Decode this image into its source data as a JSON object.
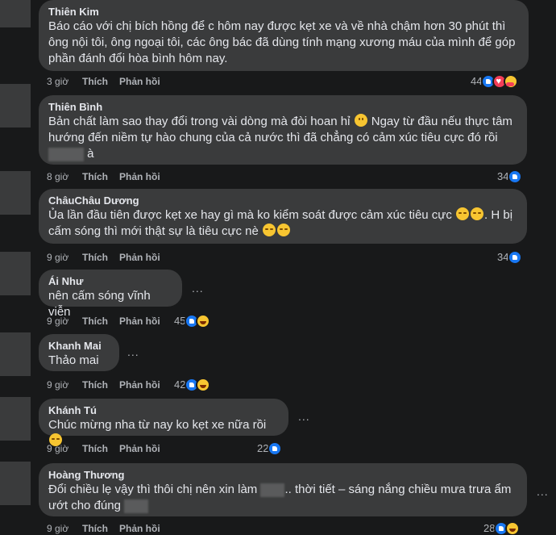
{
  "comments": [
    {
      "name": "Thiên Kim",
      "text": "Báo cáo với chị bích hồng để c hôm nay được kẹt xe và về nhà chậm hơn 30 phút thì ông nội tôi, ông ngoại tôi, các ông bác đã dùng tính mạng xương máu của mình để góp phần đánh đổi hòa bình hôm nay.",
      "time": "3 giờ",
      "like": "Thích",
      "reply": "Phản hồi",
      "reaction_count": "44",
      "reactions": [
        "like",
        "love",
        "care"
      ]
    },
    {
      "name": "Thiên Bình",
      "text_a": "Bản chất làm sao thay đổi trong vài dòng mà đòi hoan hỉ ",
      "text_b": " Ngay từ đầu nếu thực tâm hướng đến niềm tự hào chung của cả nước thì đã chẳng có cảm xúc tiêu cực đó rồi",
      "text_c": " à",
      "time": "8 giờ",
      "like": "Thích",
      "reply": "Phản hồi",
      "reaction_count": "34",
      "reactions": [
        "like"
      ]
    },
    {
      "name": "ChâuChâu Dương",
      "text_a": "Ủa lần đầu tiên được kẹt xe hay gì mà ko kiểm soát được cảm xúc tiêu cực ",
      "text_b": ". H bị cấm sóng thì mới thật sự là tiêu cực nè ",
      "time": "9 giờ",
      "like": "Thích",
      "reply": "Phản hồi",
      "reaction_count": "34",
      "reactions": [
        "like"
      ]
    },
    {
      "name": "Ái Như",
      "text": "nên cấm sóng vĩnh viễn",
      "time": "9 giờ",
      "like": "Thích",
      "reply": "Phản hồi",
      "reaction_count": "45",
      "reactions": [
        "like",
        "haha"
      ]
    },
    {
      "name": "Khanh Mai",
      "text": "Thảo mai",
      "time": "9 giờ",
      "like": "Thích",
      "reply": "Phản hồi",
      "reaction_count": "42",
      "reactions": [
        "like",
        "haha"
      ]
    },
    {
      "name": "Khánh Tú",
      "text": "Chúc mừng nha từ nay ko kẹt xe nữa rồi ",
      "time": "9 giờ",
      "like": "Thích",
      "reply": "Phản hồi",
      "reaction_count": "22",
      "reactions": [
        "like"
      ]
    },
    {
      "name": "Hoàng Thương",
      "text_a": "Đổi chiều lẹ vậy thì thôi chị nên xin làm ",
      "text_b": ".. thời tiết – sáng nắng chiều mưa trưa ẩm ướt cho đúng ",
      "time": "9 giờ",
      "like": "Thích",
      "reply": "Phản hồi",
      "reaction_count": "28",
      "reactions": [
        "like",
        "haha"
      ]
    }
  ],
  "more_label": "..."
}
